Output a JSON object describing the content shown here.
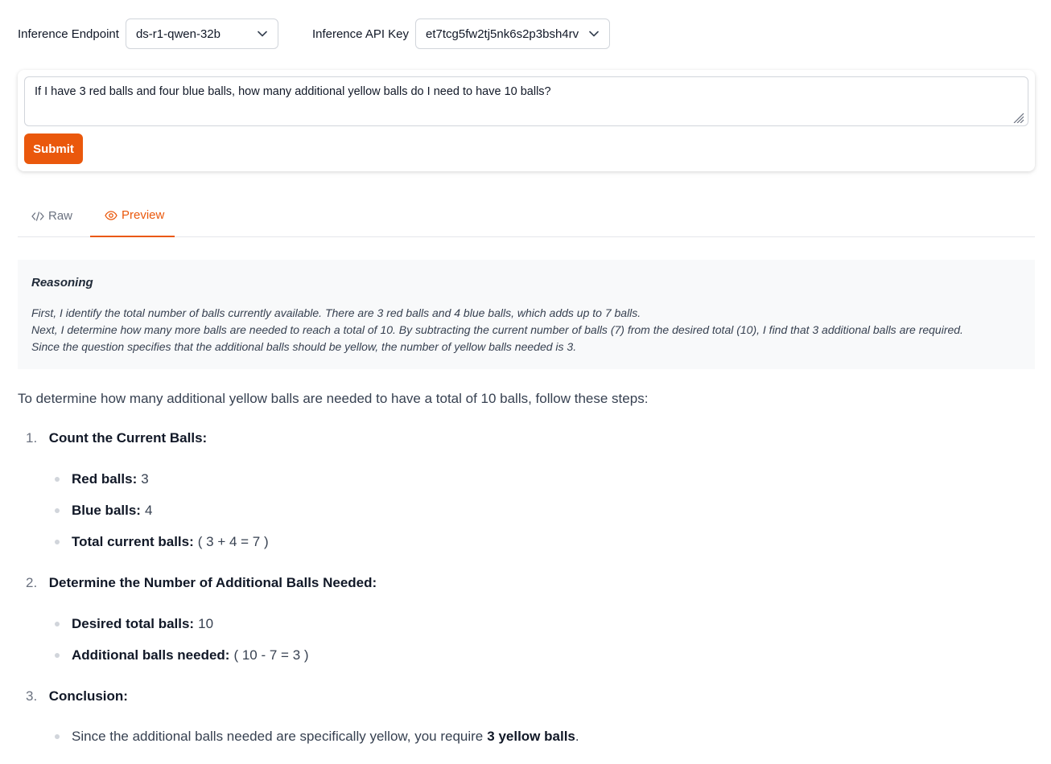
{
  "controls": {
    "endpoint_label": "Inference Endpoint",
    "endpoint_value": "ds-r1-qwen-32b",
    "api_key_label": "Inference API Key",
    "api_key_value": "et7tcg5fw2tj5nk6s2p3bsh4rv"
  },
  "prompt": {
    "text": "If I have 3 red balls and four blue balls, how many additional yellow balls do I need to have 10 balls?",
    "submit_label": "Submit"
  },
  "tabs": [
    {
      "label": "Raw",
      "icon": "code-icon",
      "active": false
    },
    {
      "label": "Preview",
      "icon": "eye-icon",
      "active": true
    }
  ],
  "reasoning": {
    "title": "Reasoning",
    "lines": [
      "First, I identify the total number of balls currently available. There are 3 red balls and 4 blue balls, which adds up to 7 balls.",
      "Next, I determine how many more balls are needed to reach a total of 10. By subtracting the current number of balls (7) from the desired total (10), I find that 3 additional balls are required.",
      "Since the question specifies that the additional balls should be yellow, the number of yellow balls needed is 3."
    ]
  },
  "answer": {
    "intro": "To determine how many additional yellow balls are needed to have a total of 10 balls, follow these steps:",
    "steps": [
      {
        "num": "1.",
        "title": "Count the Current Balls:",
        "bullets": [
          {
            "key": "Red balls:",
            "value": "3"
          },
          {
            "key": "Blue balls:",
            "value": "4"
          },
          {
            "key": "Total current balls:",
            "value": "( 3 + 4 = 7 )"
          }
        ]
      },
      {
        "num": "2.",
        "title": "Determine the Number of Additional Balls Needed:",
        "bullets": [
          {
            "key": "Desired total balls:",
            "value": "10"
          },
          {
            "key": "Additional balls needed:",
            "value": "( 10 - 7 = 3 )"
          }
        ]
      },
      {
        "num": "3.",
        "title": "Conclusion:",
        "bullets": [
          {
            "text": "Since the additional balls needed are specifically yellow, you require",
            "bold": "3 yellow balls",
            "end": "."
          }
        ]
      }
    ]
  },
  "colors": {
    "accent": "#ea580c",
    "reasoning_bg": "#f8f9fa"
  }
}
